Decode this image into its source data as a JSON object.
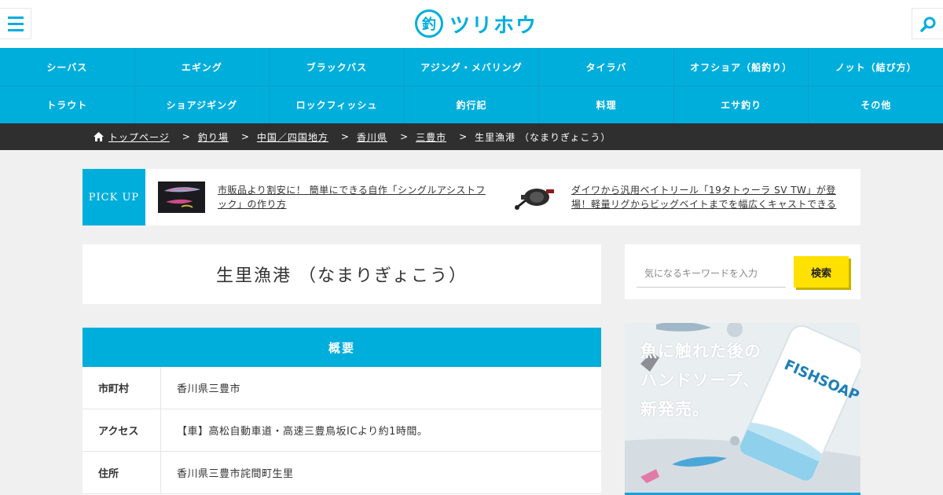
{
  "header": {
    "logo_mark": "釣",
    "logo_text": "ツリホウ"
  },
  "nav": {
    "row1": [
      "シーバス",
      "エギング",
      "ブラックバス",
      "アジング・メバリング",
      "タイラバ",
      "オフショア（船釣り）",
      "ノット（結び方）"
    ],
    "row2": [
      "トラウト",
      "ショアジギング",
      "ロックフィッシュ",
      "釣行記",
      "料理",
      "エサ釣り",
      "その他"
    ]
  },
  "breadcrumb": {
    "links": [
      "トップページ",
      "釣り場",
      "中国／四国地方",
      "香川県",
      "三豊市"
    ],
    "separator": ">",
    "current": "生里漁港 （なまりぎょこう）"
  },
  "pickup": {
    "label": "PICK UP",
    "items": [
      {
        "text_line1": "市販品より割安に！ 簡単にできる自作「シングルアシストフ",
        "text_line2": "ック」の作り方"
      },
      {
        "text_line1": "ダイワから汎用ベイトリール「19タトゥーラ SV TW」が登",
        "text_line2": "場！軽量リグからビッグベイトまでを幅広くキャストできる"
      }
    ]
  },
  "page": {
    "title": "生里漁港 （なまりぎょこう）"
  },
  "overview": {
    "heading": "概要",
    "rows": [
      {
        "label": "市町村",
        "value": "香川県三豊市"
      },
      {
        "label": "アクセス",
        "value": "【車】高松自動車道・高速三豊鳥坂ICより約1時間。"
      },
      {
        "label": "住所",
        "value": "香川県三豊市詫間町生里"
      }
    ]
  },
  "sidebar": {
    "search_placeholder": "気になるキーワードを入力",
    "search_button": "検索",
    "ad": {
      "line1": "魚に触れた後の",
      "line2": "ハンドソープ、",
      "line3": "新発売。",
      "product": "FISHSOAP"
    }
  },
  "colors": {
    "primary": "#00aedc",
    "breadcrumb_bg": "#2f2f2f",
    "page_bg": "#f0f0f0",
    "search_button": "#ffe100"
  }
}
